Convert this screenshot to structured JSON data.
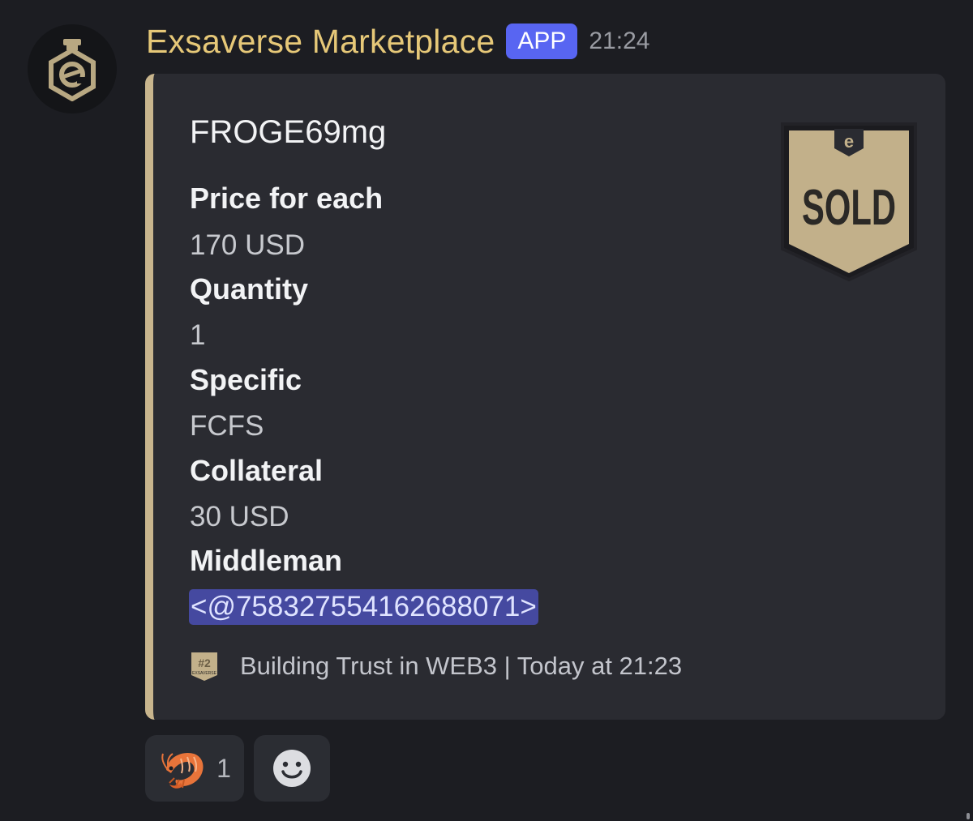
{
  "author": {
    "name": "Exsaverse Marketplace",
    "badge": "APP",
    "time": "21:24"
  },
  "embed": {
    "title": "FROGE69mg",
    "fields": [
      {
        "name": "Price for each",
        "value": "170 USD"
      },
      {
        "name": "Quantity",
        "value": "1"
      },
      {
        "name": "Specific",
        "value": "FCFS"
      },
      {
        "name": "Collateral",
        "value": "30 USD"
      },
      {
        "name": "Middleman",
        "value": ""
      }
    ],
    "mention": "<@758327554162688071>",
    "thumbnail_text": "SOLD",
    "footer": {
      "text": "Building Trust in WEB3 | Today at 21:23",
      "icon_text": "#2",
      "icon_subtext": "EXSAVERSE"
    },
    "accent_color": "#c8b58d"
  },
  "reactions": [
    {
      "emoji": "shrimp-icon",
      "count": "1"
    }
  ],
  "add_reaction_icon": "smiley-icon"
}
